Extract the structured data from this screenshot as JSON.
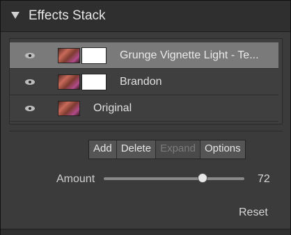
{
  "panel": {
    "title": "Effects Stack"
  },
  "layers": [
    {
      "label": "Grunge Vignette Light - Te...",
      "selected": true
    },
    {
      "label": "Brandon",
      "selected": false
    },
    {
      "label": "Original",
      "selected": false
    }
  ],
  "buttons": {
    "add": "Add",
    "delete": "Delete",
    "expand": "Expand",
    "options": "Options"
  },
  "amount": {
    "label": "Amount",
    "value": "72",
    "fraction": 0.72
  },
  "reset_label": "Reset"
}
